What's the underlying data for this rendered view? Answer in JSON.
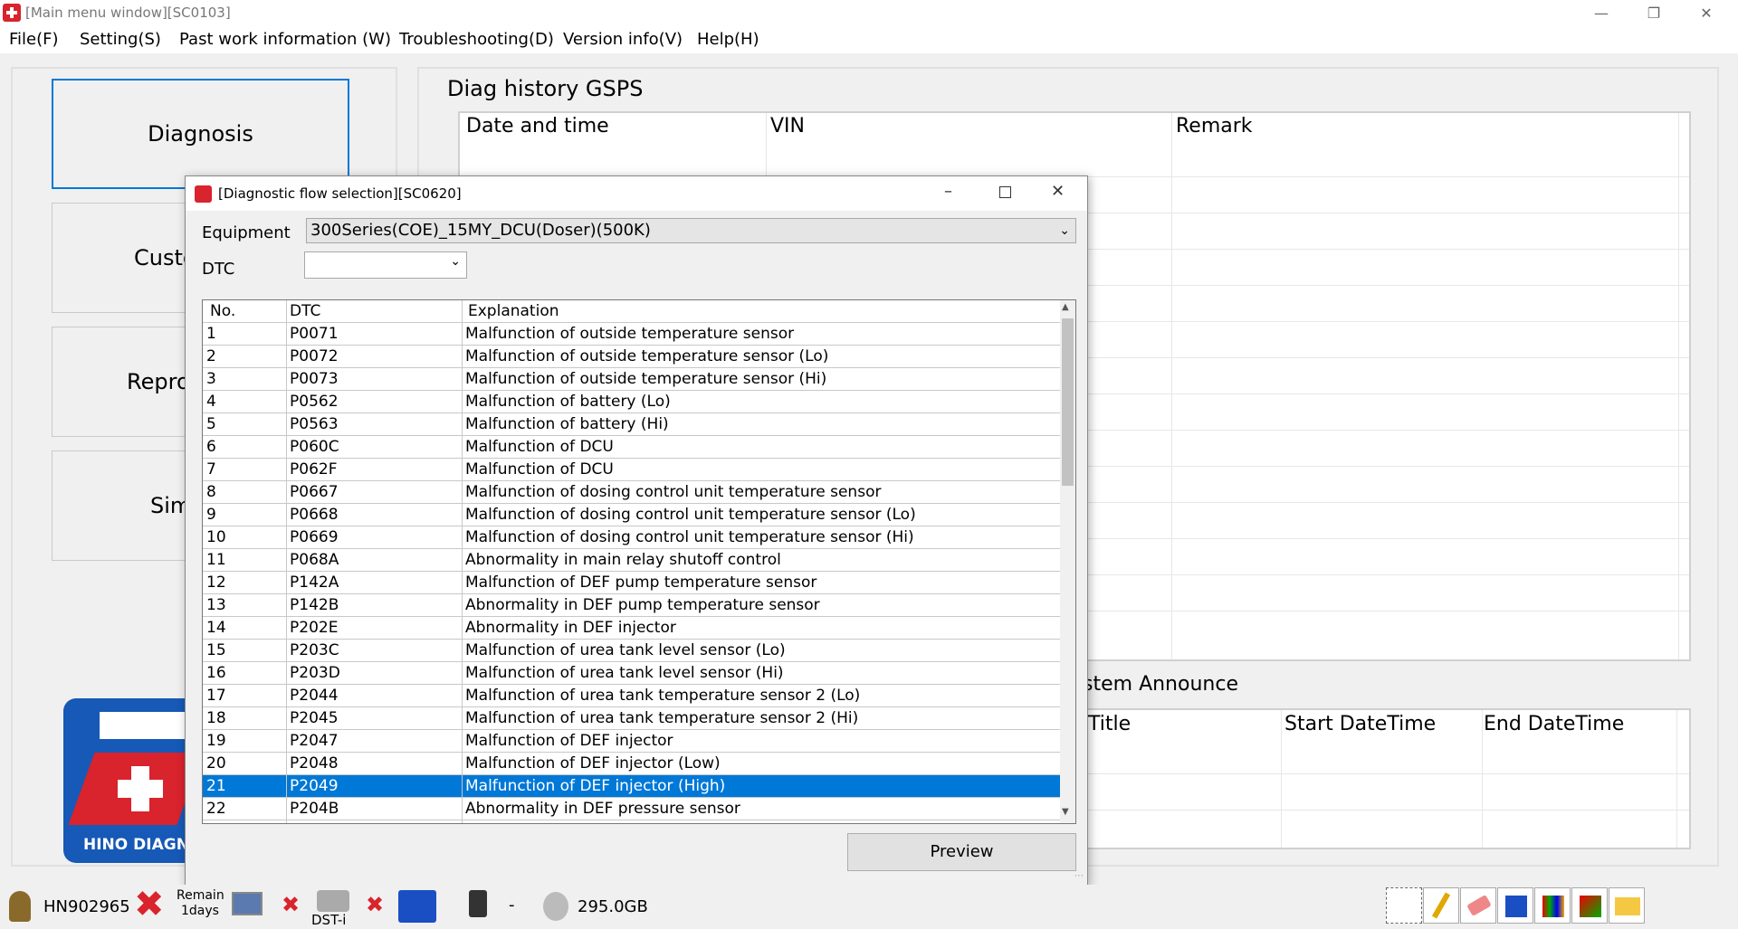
{
  "window": {
    "title": "[Main menu window][SC0103]"
  },
  "menu": [
    "File(F)",
    "Setting(S)",
    "Past work information (W)",
    "Troubleshooting(D)",
    "Version info(V)",
    "Help(H)"
  ],
  "left": {
    "buttons": [
      "Diagnosis",
      "Custo",
      "Repro",
      "Sim"
    ],
    "logo_text": "HINO DIAGN"
  },
  "history": {
    "title": "Diag history GSPS",
    "columns": [
      "Date and time",
      "VIN",
      "Remark"
    ]
  },
  "announce": {
    "title": "ystem Announce",
    "columns": [
      "Title",
      "Start DateTime",
      "End DateTime"
    ]
  },
  "dialog": {
    "title": "[Diagnostic flow selection][SC0620]",
    "equipment_label": "Equipment",
    "equipment_value": "300Series(COE)_15MY_DCU(Doser)(500K)",
    "dtc_label": "DTC",
    "dtc_value": "",
    "columns": [
      "No.",
      "DTC",
      "Explanation"
    ],
    "rows": [
      [
        "1",
        "P0071",
        "Malfunction of outside temperature sensor"
      ],
      [
        "2",
        "P0072",
        "Malfunction of outside temperature sensor (Lo)"
      ],
      [
        "3",
        "P0073",
        "Malfunction of outside temperature sensor (Hi)"
      ],
      [
        "4",
        "P0562",
        "Malfunction of battery (Lo)"
      ],
      [
        "5",
        "P0563",
        "Malfunction of battery (Hi)"
      ],
      [
        "6",
        "P060C",
        "Malfunction of DCU"
      ],
      [
        "7",
        "P062F",
        "Malfunction of DCU"
      ],
      [
        "8",
        "P0667",
        "Malfunction of dosing control unit temperature sensor"
      ],
      [
        "9",
        "P0668",
        "Malfunction of dosing control unit temperature sensor (Lo)"
      ],
      [
        "10",
        "P0669",
        "Malfunction of dosing control unit temperature sensor (Hi)"
      ],
      [
        "11",
        "P068A",
        "Abnormality in main relay shutoff control"
      ],
      [
        "12",
        "P142A",
        "Malfunction of DEF pump temperature sensor"
      ],
      [
        "13",
        "P142B",
        "Abnormality in DEF pump temperature sensor"
      ],
      [
        "14",
        "P202E",
        "Abnormality in DEF injector"
      ],
      [
        "15",
        "P203C",
        "Malfunction of urea tank level sensor (Lo)"
      ],
      [
        "16",
        "P203D",
        "Malfunction of urea tank level sensor (Hi)"
      ],
      [
        "17",
        "P2044",
        "Malfunction of urea tank temperature sensor 2 (Lo)"
      ],
      [
        "18",
        "P2045",
        "Malfunction of urea tank temperature sensor 2 (Hi)"
      ],
      [
        "19",
        "P2047",
        "Malfunction of DEF injector"
      ],
      [
        "20",
        "P2048",
        "Malfunction of DEF injector (Low)"
      ],
      [
        "21",
        "P2049",
        "Malfunction of DEF injector (High)"
      ],
      [
        "22",
        "P204B",
        "Abnormality in DEF pressure sensor"
      ]
    ],
    "selected_row": 21,
    "preview_label": "Preview"
  },
  "status": {
    "user": "HN902965",
    "remain": "Remain",
    "days": "1days",
    "dst": "DST-i",
    "dash": "-",
    "disk": "295.0GB"
  }
}
